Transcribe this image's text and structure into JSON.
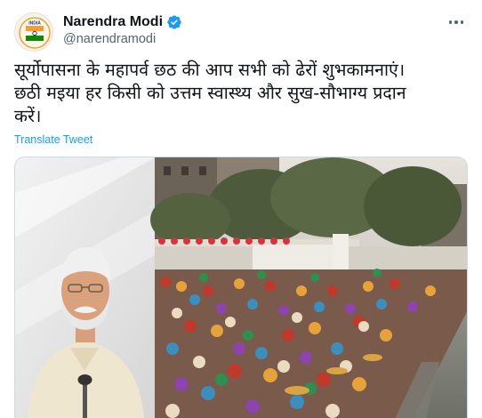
{
  "user": {
    "display_name": "Narendra Modi",
    "handle": "@narendramodi",
    "avatar_badge_text": "INDIA"
  },
  "tweet": {
    "line1": "सूर्योपासना के महापर्व छठ की आप सभी को ढेरों शुभकामनाएं।",
    "line2": "छठी मइया हर किसी को उत्तम स्वास्थ्य और सुख-सौभाग्य प्रदान",
    "line3": "करें।",
    "translate_label": "Translate Tweet"
  },
  "icons": {
    "verified": "verified-badge-icon",
    "more": "more-options-icon"
  },
  "colors": {
    "accent": "#1d9bf0",
    "secondary_text": "#536471",
    "primary_text": "#0f1419"
  }
}
